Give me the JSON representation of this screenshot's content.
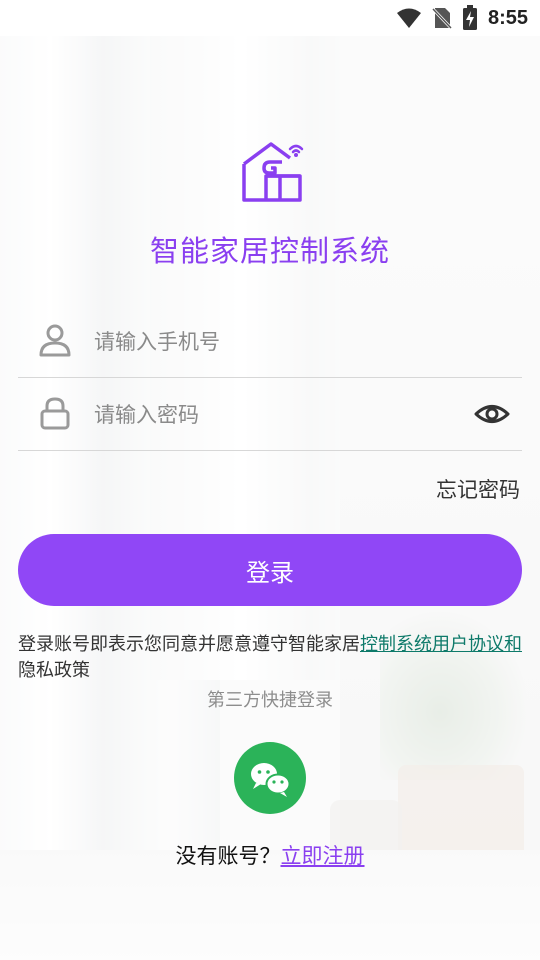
{
  "status_bar": {
    "time": "8:55"
  },
  "app": {
    "title": "智能家居控制系统"
  },
  "form": {
    "phone_placeholder": "请输入手机号",
    "phone_value": "",
    "password_placeholder": "请输入密码",
    "password_value": ""
  },
  "links": {
    "forgot_password": "忘记密码"
  },
  "buttons": {
    "login": "登录"
  },
  "agreement": {
    "prefix": "登录账号即表示您同意并愿意遵守智能家居",
    "link_text": "控制系统用户协议和",
    "suffix": "隐私政策"
  },
  "third_party": {
    "label": "第三方快捷登录",
    "wechat_icon": "wechat-icon"
  },
  "register": {
    "prompt": "没有账号？",
    "link": "立即注册"
  },
  "colors": {
    "accent": "#8a3ff0",
    "button": "#9047f6",
    "wechat": "#2bb359",
    "link_green": "#0e7a6a"
  }
}
